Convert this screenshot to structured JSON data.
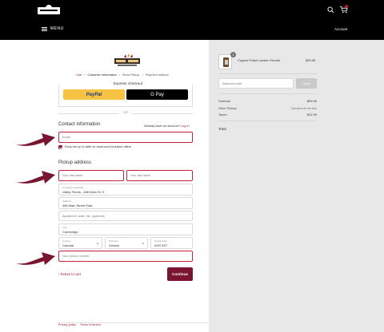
{
  "header": {
    "menu_label": "MENU",
    "account_label": "Account"
  },
  "breadcrumb": {
    "items": [
      "Cart",
      "Customer information",
      "Store Pickup",
      "Payment method"
    ],
    "separator": "›"
  },
  "express": {
    "title": "Express checkout",
    "paypal_label": "PayPal",
    "gpay_label": "G Pay",
    "or_label": "OR"
  },
  "contact": {
    "title": "Contact information",
    "signin_prompt": "Already have an account?",
    "signin_link": "Log in",
    "email_placeholder": "Email",
    "newsletter_label": "Keep me up to date on news and exclusive offers",
    "newsletter_checked": true
  },
  "pickup": {
    "title": "Pickup address",
    "first_name_placeholder": "Your first name",
    "last_name_placeholder": "Your last name",
    "company_label": "Company (optional)",
    "company_value": "Valley Feeds - 486 Main St. E",
    "address_label": "Address",
    "address_value": "486 Main Street East",
    "apartment_placeholder": "Apartment, suite, etc. (optional)",
    "city_label": "City",
    "city_value": "Cambridge",
    "country_label": "Country",
    "country_value": "Canada",
    "province_label": "Province",
    "province_value": "Ontario",
    "postal_label": "Postal code",
    "postal_value": "N1R 5S7",
    "phone_placeholder": "Your phone number"
  },
  "actions": {
    "return_label": "‹ Return to cart",
    "continue_label": "Continue"
  },
  "footer": {
    "links": [
      "Privacy policy",
      "Terms of service"
    ]
  },
  "summary": {
    "product_name": "Copper Finish Lantern Feeder",
    "product_qty": "1",
    "product_price": "$99.95",
    "discount_placeholder": "Discount code",
    "apply_label": "Apply",
    "subtotal_label": "Subtotal",
    "subtotal_value": "$99.95",
    "shipping_label": "Store Pickup",
    "shipping_value": "Calculated at next step",
    "taxes_label": "Taxes",
    "taxes_value": "$12.99",
    "total_label": "Total"
  },
  "colors": {
    "accent": "#a01a35",
    "error_border": "#c3253b",
    "arrow": "#7a1530",
    "right_panel": "#e8e8e8",
    "topbar": "#000000"
  },
  "icons": [
    "search-icon",
    "cart-icon",
    "hamburger-icon",
    "arrow-pointer-icon",
    "chevron-down-icon"
  ]
}
